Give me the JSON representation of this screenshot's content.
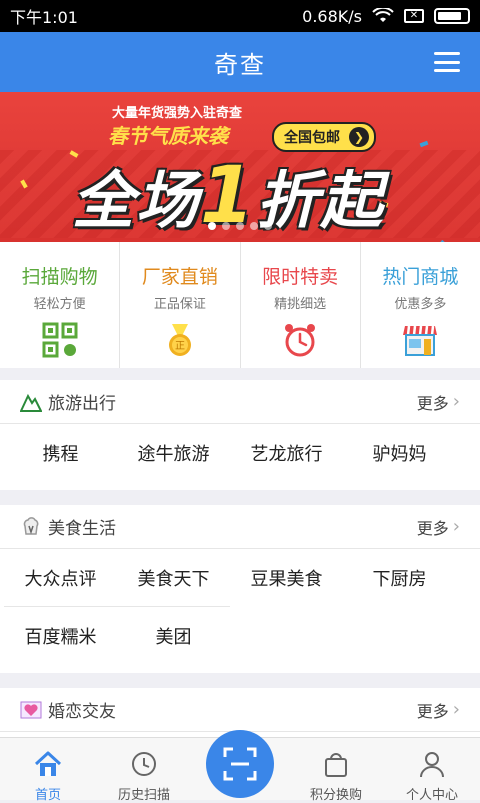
{
  "status_bar": {
    "time": "下午1:01",
    "speed": "0.68K/s"
  },
  "app_bar": {
    "title": "奇查",
    "menu_icon": "hamburger-menu-icon"
  },
  "banner": {
    "subtitle": "大量年货强势入驻奇查",
    "tagline": "春节气质来袭",
    "pill": "全国包邮",
    "headline_pre": "全场",
    "headline_num": "1",
    "headline_post": "折起",
    "dots_total": 5,
    "dots_active": 0
  },
  "features": [
    {
      "title": "扫描购物",
      "subtitle": "轻松方便",
      "color": "#5aa83a",
      "icon": "qr-code-icon"
    },
    {
      "title": "厂家直销",
      "subtitle": "正品保证",
      "color": "#e08a1e",
      "icon": "medal-icon"
    },
    {
      "title": "限时特卖",
      "subtitle": "精挑细选",
      "color": "#e8474c",
      "icon": "alarm-clock-icon"
    },
    {
      "title": "热门商城",
      "subtitle": "优惠多多",
      "color": "#3aa0d8",
      "icon": "store-icon"
    }
  ],
  "sections": [
    {
      "title": "旅游出行",
      "more": "更多",
      "icon": "mountain-icon",
      "items": [
        "携程",
        "途牛旅游",
        "艺龙旅行",
        "驴妈妈"
      ]
    },
    {
      "title": "美食生活",
      "more": "更多",
      "icon": "chef-hat-icon",
      "items": [
        "大众点评",
        "美食天下",
        "豆果美食",
        "下厨房",
        "百度糯米",
        "美团"
      ]
    },
    {
      "title": "婚恋交友",
      "more": "更多",
      "icon": "love-icon",
      "items": []
    }
  ],
  "tabbar": [
    {
      "label": "首页",
      "icon": "home-icon",
      "active": true
    },
    {
      "label": "历史扫描",
      "icon": "history-icon",
      "active": false
    },
    {
      "label": "",
      "icon": "scan-icon",
      "active": false
    },
    {
      "label": "积分换购",
      "icon": "shopping-bag-icon",
      "active": false
    },
    {
      "label": "个人中心",
      "icon": "user-icon",
      "active": false
    }
  ],
  "colors": {
    "primary": "#3a86e8",
    "banner_red": "#e9433d",
    "headline_yellow": "#ffe04a"
  }
}
